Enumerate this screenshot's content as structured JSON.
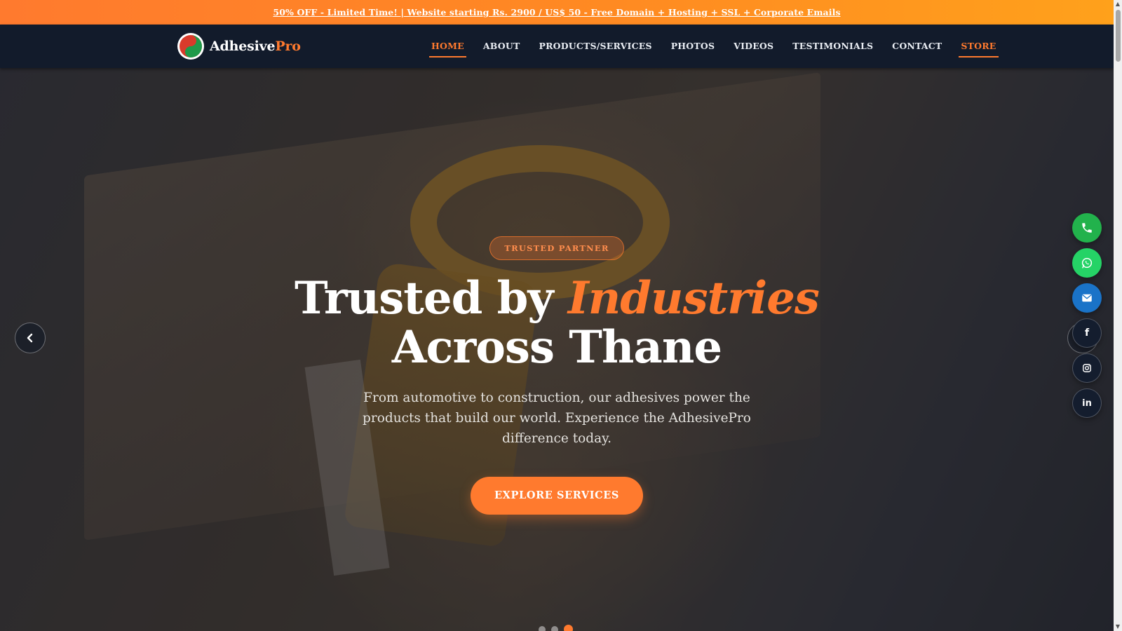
{
  "promo": {
    "text": "50% OFF - Limited Time! | Website starting Rs. 2900 / US$ 50 - Free Domain + Hosting + SSL + Corporate Emails"
  },
  "brand": {
    "name_main": "Adhesive",
    "name_accent": "Pro",
    "logo_icon": "logo-icon"
  },
  "nav": {
    "items": [
      {
        "label": "HOME",
        "active": true
      },
      {
        "label": "ABOUT"
      },
      {
        "label": "PRODUCTS/SERVICES"
      },
      {
        "label": "PHOTOS"
      },
      {
        "label": "VIDEOS"
      },
      {
        "label": "TESTIMONIALS"
      },
      {
        "label": "CONTACT"
      },
      {
        "label": "STORE"
      }
    ]
  },
  "hero": {
    "badge": "TRUSTED PARTNER",
    "headline_part1": "Trusted by ",
    "headline_highlight": "Industries",
    "headline_part2": "Across Thane",
    "subtitle": "From automotive to construction, our adhesives power the products that build our world. Experience the AdhesivePro difference today.",
    "cta_label": "EXPLORE SERVICES",
    "slides": 3,
    "active_slide": 3
  },
  "floating": [
    {
      "name": "phone-icon",
      "color": "#22b24c"
    },
    {
      "name": "whatsapp-icon",
      "color": "#25d366"
    },
    {
      "name": "mail-icon",
      "color": "#1a73c8"
    },
    {
      "name": "facebook-icon",
      "color": "#141d2e"
    },
    {
      "name": "instagram-icon",
      "color": "#141d2e"
    },
    {
      "name": "linkedin-icon",
      "color": "#141d2e"
    }
  ],
  "colors": {
    "accent": "#ff7a2e",
    "nav_bg": "#121b2b",
    "promo_gradient_start": "#ff7a2e",
    "promo_gradient_end": "#ffa11b"
  }
}
